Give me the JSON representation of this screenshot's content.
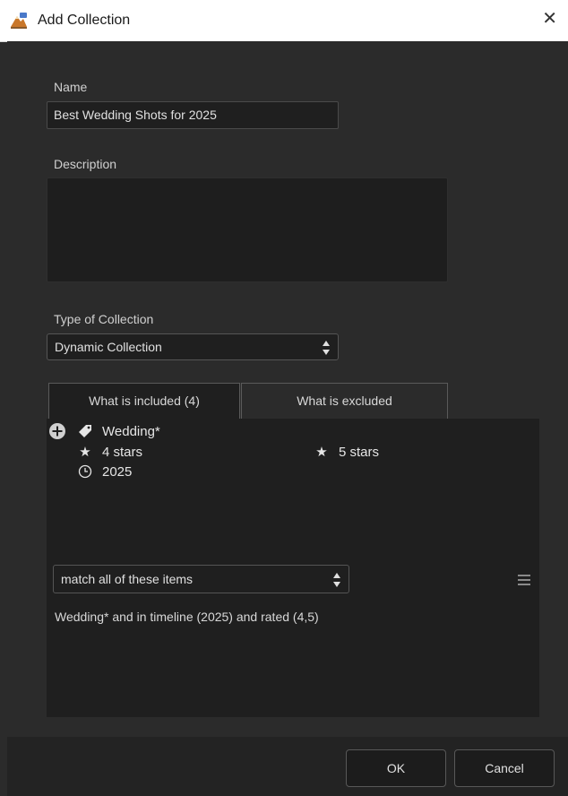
{
  "window": {
    "title": "Add Collection",
    "close_glyph": "✕"
  },
  "form": {
    "name_label": "Name",
    "name_value": "Best Wedding Shots for 2025",
    "description_label": "Description",
    "description_value": "",
    "type_label": "Type of Collection",
    "type_value": "Dynamic Collection"
  },
  "tabs": [
    {
      "label": "What is included (4)",
      "active": true
    },
    {
      "label": "What is excluded",
      "active": false
    }
  ],
  "criteria": [
    {
      "icon": "tag-icon",
      "label": "Wedding*"
    },
    {
      "icon": "star-icon",
      "label": "4 stars"
    },
    {
      "icon": "star-icon",
      "label": "5 stars"
    },
    {
      "icon": "clock-icon",
      "label": "2025"
    }
  ],
  "match": {
    "value": "match all of these items",
    "summary": "Wedding* and in timeline (2025) and rated  (4,5)"
  },
  "buttons": {
    "ok": "OK",
    "cancel": "Cancel"
  },
  "colors": {
    "background": "#2b2b2b",
    "panel": "#1f1f1f",
    "text": "#d8d8d8",
    "titlebar": "#ffffff"
  }
}
